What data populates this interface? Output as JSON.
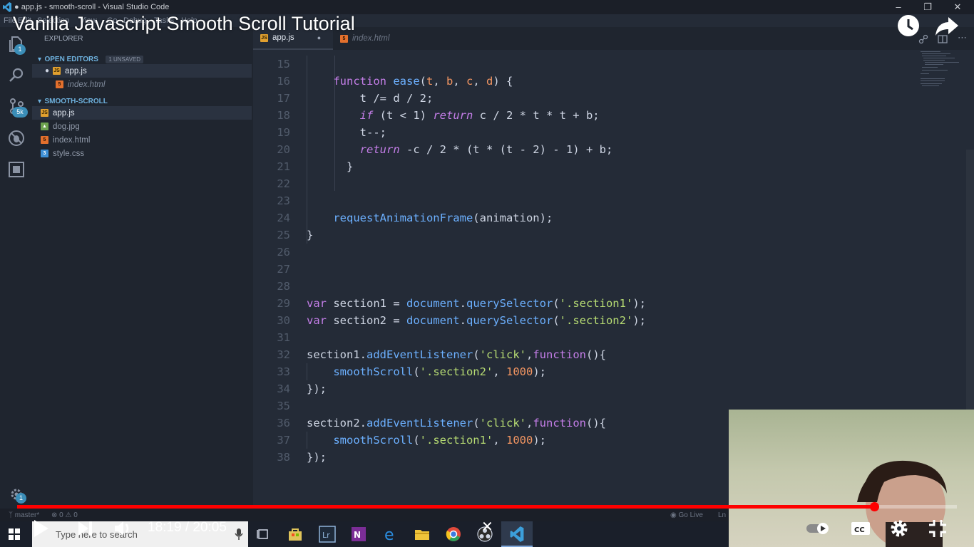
{
  "window": {
    "title": "● app.js - smooth-scroll - Visual Studio Code",
    "menu": [
      "File",
      "Edit",
      "Selection",
      "View",
      "Go",
      "Debug",
      "Tasks",
      "Help"
    ]
  },
  "video": {
    "title": "Vanilla Javascript Smooth Scroll Tutorial",
    "current_time": "18:19",
    "duration": "20:05",
    "time_separator": " / ",
    "progress": 0.912
  },
  "activity_bar": {
    "explorer_badge": "1",
    "scm_badge": "5k",
    "settings_badge": "1"
  },
  "sidebar": {
    "header": "EXPLORER",
    "open_editors_label": "OPEN EDITORS",
    "unsaved_label": "1 UNSAVED",
    "open_editors": [
      {
        "name": "app.js",
        "type": "js"
      },
      {
        "name": "index.html",
        "type": "html"
      }
    ],
    "project_label": "SMOOTH-SCROLL",
    "files": [
      {
        "name": "app.js",
        "type": "js"
      },
      {
        "name": "dog.jpg",
        "type": "img"
      },
      {
        "name": "index.html",
        "type": "html"
      },
      {
        "name": "style.css",
        "type": "css"
      }
    ]
  },
  "tabs": [
    {
      "label": "app.js",
      "active": true
    },
    {
      "label": "index.html",
      "active": false
    }
  ],
  "editor": {
    "line_numbers": [
      "15",
      "16",
      "17",
      "18",
      "19",
      "20",
      "21",
      "22",
      "23",
      "24",
      "25",
      "26",
      "27",
      "28",
      "29",
      "30",
      "31",
      "32",
      "33",
      "34",
      "35",
      "36",
      "37",
      "38"
    ],
    "code": {
      "l16_kw": "function",
      "l16_fn": "ease",
      "l16_open": "(",
      "l16_t": "t",
      "l16_b": "b",
      "l16_c": "c",
      "l16_d": "d",
      "l16_close": ") {",
      "l17": "t /= d / 2;",
      "l18_if": "if",
      "l18_mid": " (t < 1) ",
      "l18_ret": "return",
      "l18_rest": " c / 2 * t * t + b;",
      "l19": "t--;",
      "l20_ret": "return",
      "l20_rest": " -c / 2 * (t * (t - 2) - 1) + b;",
      "l21": "}",
      "l24_fn": "requestAnimationFrame",
      "l24_rest": "(animation);",
      "l25": "}",
      "l29_var": "var",
      "l29_name": " section1 = ",
      "l29_doc": "document",
      "l29_dot": ".",
      "l29_fn": "querySelector",
      "l29_open": "(",
      "l29_str": "'.section1'",
      "l29_close": ");",
      "l30_var": "var",
      "l30_name": " section2 = ",
      "l30_doc": "document",
      "l30_dot": ".",
      "l30_fn": "querySelector",
      "l30_open": "(",
      "l30_str": "'.section2'",
      "l30_close": ");",
      "l32_obj": "section1.",
      "l32_fn": "addEventListener",
      "l32_open": "(",
      "l32_str": "'click'",
      "l32_comma": ",",
      "l32_kw": "function",
      "l32_close": "(){",
      "l33_fn": "smoothScroll",
      "l33_open": "(",
      "l33_str": "'.section2'",
      "l33_comma": ", ",
      "l33_num": "1000",
      "l33_close": ");",
      "l34": "});",
      "l36_obj": "section2.",
      "l36_fn": "addEventListener",
      "l36_open": "(",
      "l36_str": "'click'",
      "l36_comma": ",",
      "l36_kw": "function",
      "l36_close": "(){",
      "l37_fn": "smoothScroll",
      "l37_open": "(",
      "l37_str": "'.section1'",
      "l37_comma": ", ",
      "l37_num": "1000",
      "l37_close": ");",
      "l38": "});"
    }
  },
  "statusbar": {
    "branch": "master*",
    "errors": "0",
    "warnings": "0",
    "golive": "Go Live",
    "position": "Ln"
  },
  "taskbar": {
    "search_placeholder": "Type here to search"
  },
  "colors": {
    "progress": "#ff0000",
    "editor_bg": "#242b37",
    "sidebar_bg": "#1f252f"
  }
}
